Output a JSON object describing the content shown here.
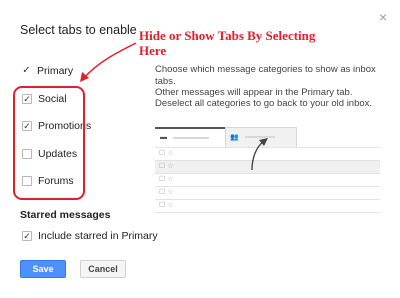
{
  "dialog": {
    "title": "Select tabs to enable",
    "close_symbol": "×"
  },
  "annotation": {
    "line1": "Hide or Show Tabs By Selecting",
    "line2": "Here"
  },
  "categories": [
    {
      "label": "Primary",
      "checked": true
    },
    {
      "label": "Social",
      "checked": true
    },
    {
      "label": "Promotions",
      "checked": true
    },
    {
      "label": "Updates",
      "checked": false
    },
    {
      "label": "Forums",
      "checked": false
    }
  ],
  "description": {
    "line1": "Choose which message categories to show as inbox tabs.",
    "line2": "Other messages will appear in the Primary tab.",
    "line3": "Deselect all categories to go back to your old inbox."
  },
  "starred": {
    "heading": "Starred messages",
    "option_label": "Include starred in Primary",
    "checked": true
  },
  "buttons": {
    "save": "Save",
    "cancel": "Cancel"
  },
  "preview": {
    "tab1_icon": "inbox-icon",
    "tab2_icon": "people-icon",
    "row_marker": "☐ ☆"
  },
  "colors": {
    "annotation": "#e0202a",
    "save_button": "#4d90fe"
  }
}
